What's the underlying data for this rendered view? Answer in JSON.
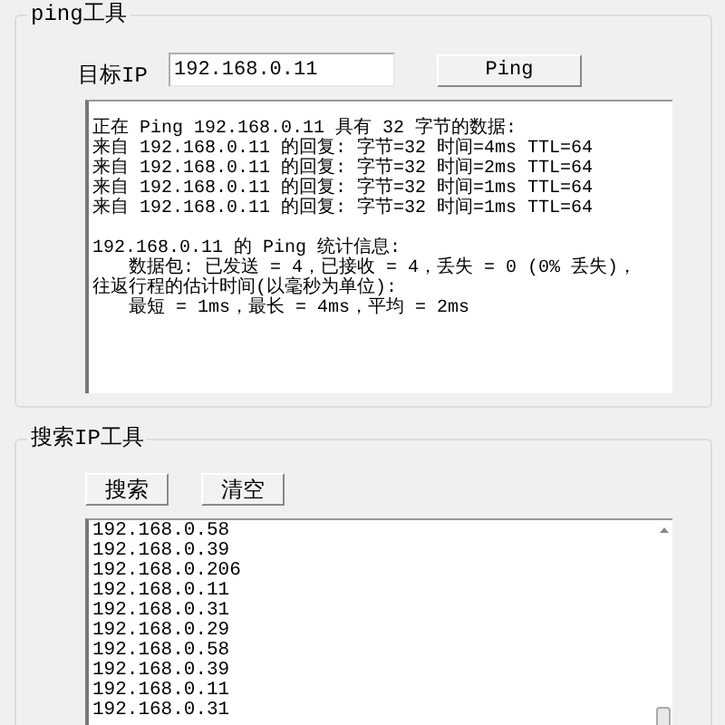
{
  "ping_tool": {
    "title": "ping工具",
    "target_label": "目标IP",
    "target_value": "192.168.0.11",
    "ping_button": "Ping",
    "output_blocks": [
      {
        "lines": [
          {
            "text": "正在 Ping 192.168.0.11 具有 32 字节的数据:",
            "indented": false
          },
          {
            "text": "来自 192.168.0.11 的回复: 字节=32 时间=4ms TTL=64",
            "indented": false
          },
          {
            "text": "来自 192.168.0.11 的回复: 字节=32 时间=2ms TTL=64",
            "indented": false
          },
          {
            "text": "来自 192.168.0.11 的回复: 字节=32 时间=1ms TTL=64",
            "indented": false
          },
          {
            "text": "来自 192.168.0.11 的回复: 字节=32 时间=1ms TTL=64",
            "indented": false
          }
        ]
      },
      {
        "lines": [
          {
            "text": "192.168.0.11 的 Ping 统计信息:",
            "indented": false
          },
          {
            "text": "数据包: 已发送 = 4，已接收 = 4，丢失 = 0 (0% 丢失)，",
            "indented": true
          },
          {
            "text": "往返行程的估计时间(以毫秒为单位):",
            "indented": false
          },
          {
            "text": "最短 = 1ms，最长 = 4ms，平均 = 2ms",
            "indented": true
          }
        ]
      }
    ]
  },
  "search_tool": {
    "title": "搜索IP工具",
    "buttons": [
      "搜索",
      "清空"
    ],
    "results": [
      "192.168.0.58",
      "192.168.0.39",
      "192.168.0.206",
      "192.168.0.11",
      "192.168.0.31",
      "192.168.0.29",
      "192.168.0.58",
      "192.168.0.39",
      "192.168.0.11",
      "192.168.0.31"
    ]
  }
}
